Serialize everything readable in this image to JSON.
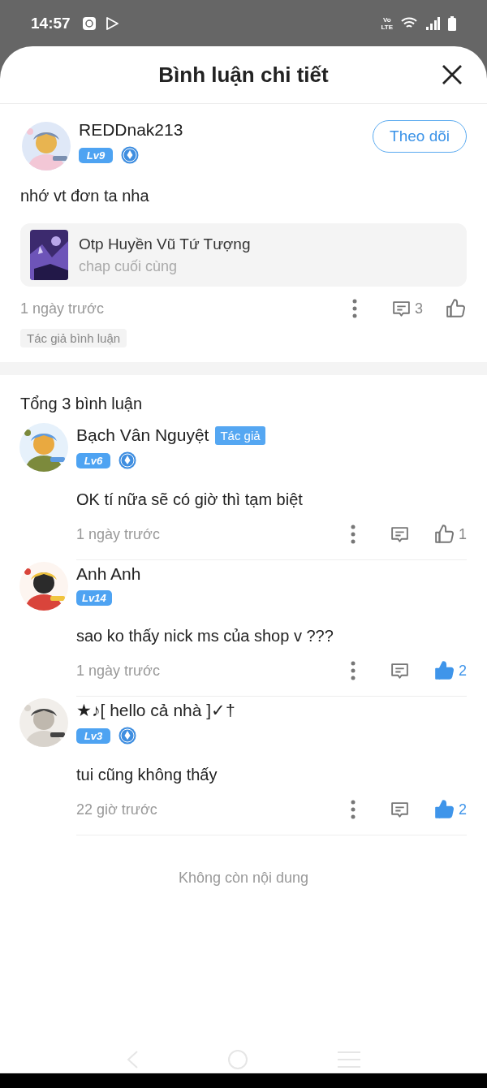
{
  "status_bar": {
    "time": "14:57",
    "volte_top": "Vo",
    "volte_bottom": "LTE"
  },
  "header": {
    "title": "Bình luận chi tiết"
  },
  "main_comment": {
    "user": "REDDnak213",
    "level": "Lv9",
    "has_badge": true,
    "follow_button": "Theo dõi",
    "text": "nhớ vt đơn ta nha",
    "story": {
      "title": "Otp Huyền Vũ Tứ Tượng",
      "chapter": "chap cuối cùng"
    },
    "time": "1 ngày trước",
    "reply_count": "3",
    "liked": false,
    "tag": "Tác giả bình luận"
  },
  "total": "Tổng 3 bình luận",
  "replies": [
    {
      "user": "Bạch Vân Nguyệt",
      "author_tag": "Tác giả",
      "level": "Lv6",
      "has_badge": true,
      "text": "OK tí nữa sẽ có giờ thì tạm biệt",
      "time": "1 ngày trước",
      "likes": "1",
      "liked": false
    },
    {
      "user": "Anh Anh",
      "level": "Lv14",
      "has_badge": false,
      "text": "sao ko thấy nick ms của shop v ???",
      "time": "1 ngày trước",
      "likes": "2",
      "liked": true
    },
    {
      "user": "★♪[ hello cả nhà ]✓†",
      "level": "Lv3",
      "has_badge": true,
      "text": "tui cũng không thấy",
      "time": "22 giờ trước",
      "likes": "2",
      "liked": true
    }
  ],
  "end_text": "Không còn nội dung"
}
